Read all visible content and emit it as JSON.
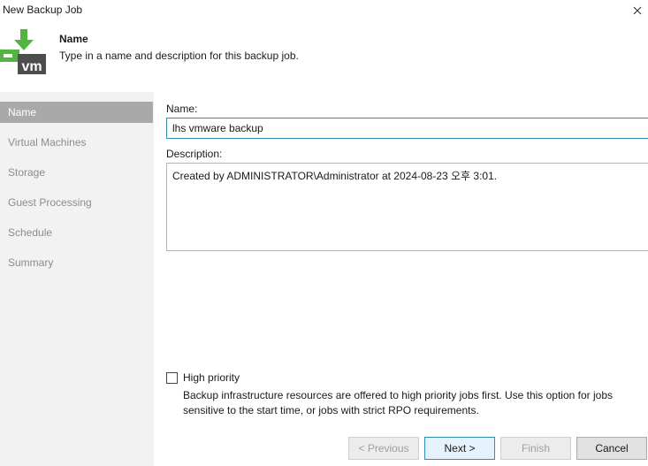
{
  "window": {
    "title": "New Backup Job"
  },
  "header": {
    "title": "Name",
    "subtitle": "Type in a name and description for this backup job.",
    "logo_text": "vm"
  },
  "nav": {
    "items": [
      {
        "label": "Name",
        "active": true
      },
      {
        "label": "Virtual Machines",
        "active": false
      },
      {
        "label": "Storage",
        "active": false
      },
      {
        "label": "Guest Processing",
        "active": false
      },
      {
        "label": "Schedule",
        "active": false
      },
      {
        "label": "Summary",
        "active": false
      }
    ]
  },
  "form": {
    "name_label": "Name:",
    "name_value": "lhs vmware backup",
    "description_label": "Description:",
    "description_value": "Created by ADMINISTRATOR\\Administrator at 2024-08-23 오후 3:01.",
    "high_priority_label": "High priority",
    "high_priority_checked": false,
    "high_priority_desc": "Backup infrastructure resources are offered to high priority jobs first. Use this option for jobs sensitive to the start time, or jobs with strict RPO requirements."
  },
  "buttons": {
    "previous": "< Previous",
    "next": "Next >",
    "finish": "Finish",
    "cancel": "Cancel"
  },
  "colors": {
    "accent": "#2f8fb5",
    "logo_green": "#52b541",
    "logo_dark": "#4d4d4d",
    "nav_active_bg": "#a9a9a9"
  }
}
